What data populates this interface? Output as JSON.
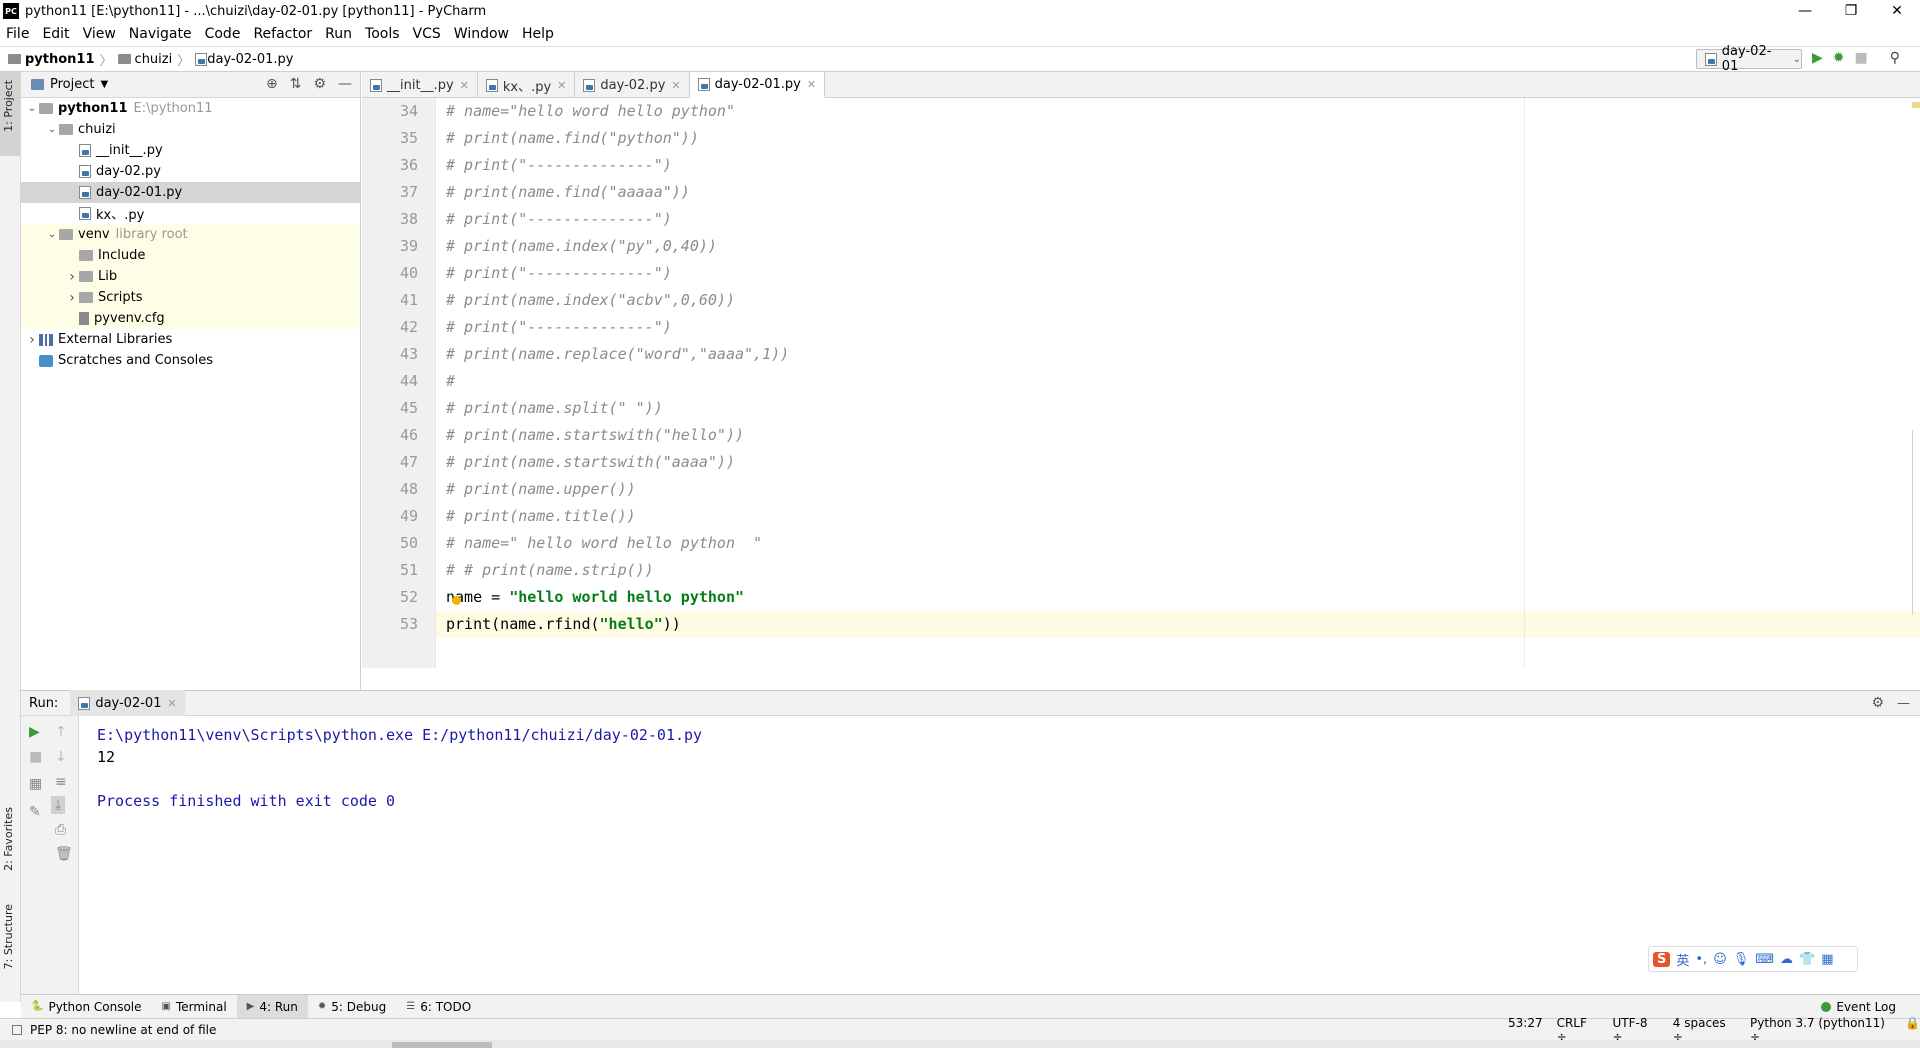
{
  "window": {
    "title": "python11 [E:\\python11] - ...\\chuizi\\day-02-01.py [python11] - PyCharm",
    "logo": "PC",
    "controls": [
      "—",
      "❐",
      "✕"
    ]
  },
  "menu": [
    "File",
    "Edit",
    "View",
    "Navigate",
    "Code",
    "Refactor",
    "Run",
    "Tools",
    "VCS",
    "Window",
    "Help"
  ],
  "breadcrumb": {
    "project": "python11",
    "folder": "chuizi",
    "file": "day-02-01.py"
  },
  "run_config": {
    "name": "day-02-01",
    "icons": [
      "run-icon",
      "debug-icon",
      "stop-icon",
      "search-icon"
    ]
  },
  "left_strip": {
    "project_tab": "1: Project",
    "favorites_tab": "2: Favorites",
    "structure_tab": "7: Structure"
  },
  "project_panel": {
    "header": "Project",
    "tree": [
      {
        "label": "python11",
        "hint": "E:\\python11",
        "type": "folder",
        "depth": 0,
        "expanded": true,
        "bold": true
      },
      {
        "label": "chuizi",
        "type": "folder",
        "depth": 1,
        "expanded": true
      },
      {
        "label": "__init__.py",
        "type": "py",
        "depth": 2
      },
      {
        "label": "day-02.py",
        "type": "py",
        "depth": 2
      },
      {
        "label": "day-02-01.py",
        "type": "py",
        "depth": 2,
        "selected": true
      },
      {
        "label": "kx、.py",
        "type": "py",
        "depth": 2
      },
      {
        "label": "venv",
        "hint": "library root",
        "type": "folder",
        "depth": 1,
        "expanded": true,
        "highlight": true
      },
      {
        "label": "Include",
        "type": "folder",
        "depth": 2,
        "highlight": true
      },
      {
        "label": "Lib",
        "type": "folder",
        "depth": 2,
        "collapsed": true,
        "highlight": true
      },
      {
        "label": "Scripts",
        "type": "folder",
        "depth": 2,
        "collapsed": true,
        "highlight": true
      },
      {
        "label": "pyvenv.cfg",
        "type": "cfg",
        "depth": 2,
        "highlight": true
      },
      {
        "label": "External Libraries",
        "type": "lib",
        "depth": 0,
        "collapsed": true
      },
      {
        "label": "Scratches and Consoles",
        "type": "scr",
        "depth": 0
      }
    ]
  },
  "editor_tabs": [
    {
      "label": "__init__.py",
      "active": false
    },
    {
      "label": "kx、.py",
      "active": false
    },
    {
      "label": "day-02.py",
      "active": false
    },
    {
      "label": "day-02-01.py",
      "active": true
    }
  ],
  "editor": {
    "lines": [
      {
        "n": "34",
        "text": "# name=\"hello word hello python\"",
        "kind": "comment"
      },
      {
        "n": "35",
        "text": "# print(name.find(\"python\"))",
        "kind": "comment"
      },
      {
        "n": "36",
        "text": "# print(\"--------------\")",
        "kind": "comment"
      },
      {
        "n": "37",
        "text": "# print(name.find(\"aaaaa\"))",
        "kind": "comment"
      },
      {
        "n": "38",
        "text": "# print(\"--------------\")",
        "kind": "comment"
      },
      {
        "n": "39",
        "text": "# print(name.index(\"py\",0,40))",
        "kind": "comment"
      },
      {
        "n": "40",
        "text": "# print(\"--------------\")",
        "kind": "comment"
      },
      {
        "n": "41",
        "text": "# print(name.index(\"acbv\",0,60))",
        "kind": "comment"
      },
      {
        "n": "42",
        "text": "# print(\"--------------\")",
        "kind": "comment"
      },
      {
        "n": "43",
        "text": "# print(name.replace(\"word\",\"aaaa\",1))",
        "kind": "comment"
      },
      {
        "n": "44",
        "text": "#",
        "kind": "comment"
      },
      {
        "n": "45",
        "text": "# print(name.split(\" \"))",
        "kind": "comment"
      },
      {
        "n": "46",
        "text": "# print(name.startswith(\"hello\"))",
        "kind": "comment"
      },
      {
        "n": "47",
        "text": "# print(name.startswith(\"aaaa\"))",
        "kind": "comment"
      },
      {
        "n": "48",
        "text": "# print(name.upper())",
        "kind": "comment"
      },
      {
        "n": "49",
        "text": "# print(name.title())",
        "kind": "comment"
      },
      {
        "n": "50",
        "text": "# name=\" hello word hello python  \"",
        "kind": "comment"
      },
      {
        "n": "51",
        "text": "# # print(name.strip())",
        "kind": "comment"
      }
    ],
    "line52": {
      "n": "52",
      "before": "name = ",
      "str": "\"hello world hello python\""
    },
    "line53": {
      "n": "53",
      "before": "print(name.rfind(",
      "str": "\"hello\"",
      "after": "))"
    }
  },
  "run_panel": {
    "label": "Run:",
    "tab": "day-02-01",
    "console": [
      {
        "text": "E:\\python11\\venv\\Scripts\\python.exe E:/python11/chuizi/day-02-01.py",
        "color": "#1a1aa6"
      },
      {
        "text": "12",
        "color": "#000000"
      },
      {
        "text": "",
        "color": "#000000"
      },
      {
        "text": "Process finished with exit code 0",
        "color": "#1a1aa6"
      }
    ]
  },
  "bottom_tabs": [
    {
      "label": "Python Console",
      "icon": "python-icon",
      "active": false
    },
    {
      "label": "Terminal",
      "icon": "terminal-icon",
      "active": false
    },
    {
      "label": "4: Run",
      "icon": "run-icon",
      "active": true
    },
    {
      "label": "5: Debug",
      "icon": "bug-icon",
      "active": false
    },
    {
      "label": "6: TODO",
      "icon": "list-icon",
      "active": false
    }
  ],
  "event_log": "Event Log",
  "status": {
    "message": "PEP 8: no newline at end of file",
    "position": "53:27",
    "line_sep": "CRLF ÷",
    "encoding": "UTF-8 ÷",
    "indent": "4 spaces ÷",
    "interpreter": "Python 3.7 (python11) ÷"
  },
  "ime": {
    "logo": "S",
    "mode": "英"
  },
  "colors": {
    "comment": "#8c8c8c",
    "string": "#067d17",
    "console_blue": "#1a1aa6",
    "current_line": "#fffae3",
    "highlight_yellow": "#fefde6"
  }
}
